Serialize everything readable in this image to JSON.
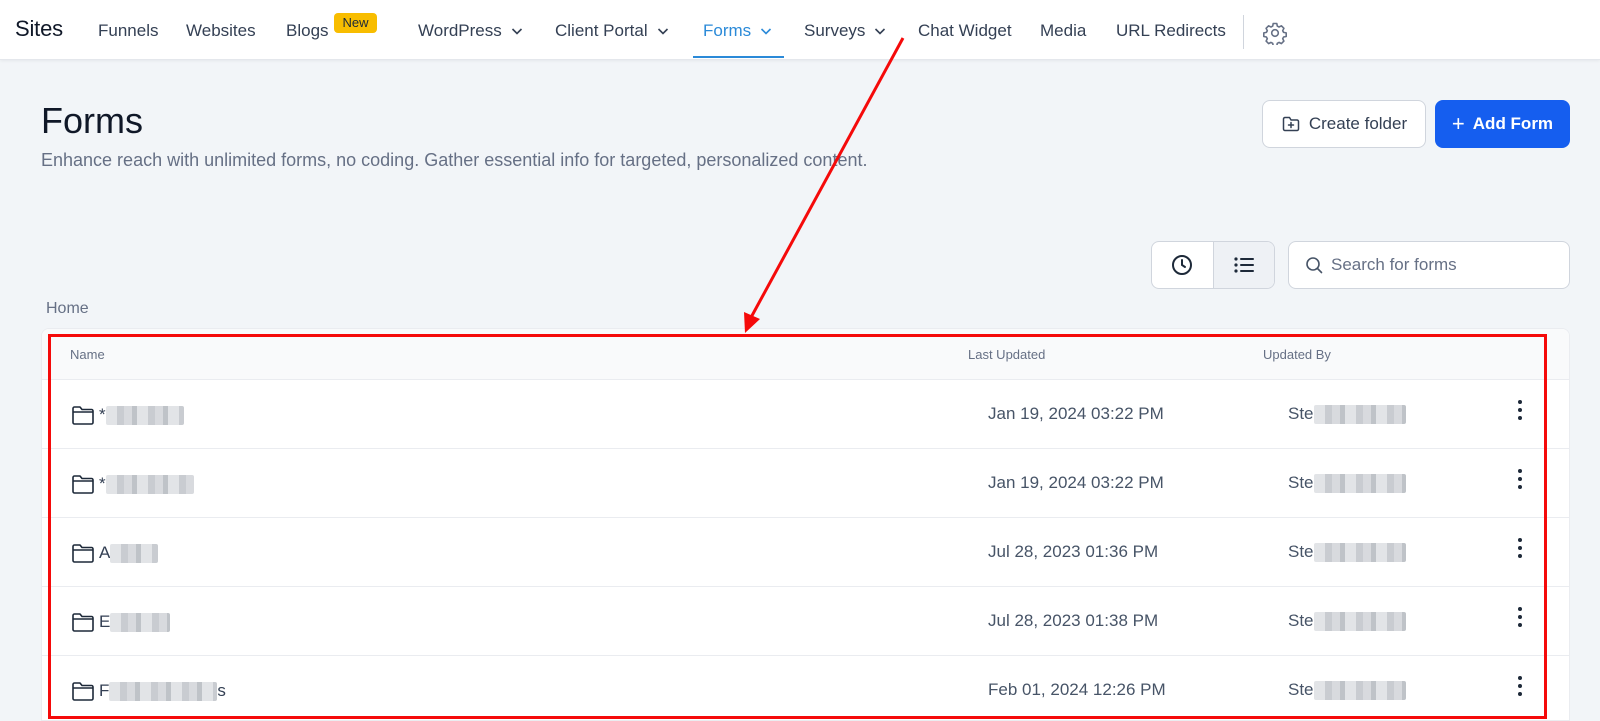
{
  "nav": {
    "brand": "Sites",
    "items": [
      {
        "label": "Funnels"
      },
      {
        "label": "Websites"
      },
      {
        "label": "Blogs",
        "badge": "New"
      },
      {
        "label": "WordPress",
        "dropdown": true
      },
      {
        "label": "Client Portal",
        "dropdown": true
      },
      {
        "label": "Forms",
        "dropdown": true,
        "active": true
      },
      {
        "label": "Surveys",
        "dropdown": true
      },
      {
        "label": "Chat Widget"
      },
      {
        "label": "Media"
      },
      {
        "label": "URL Redirects"
      }
    ],
    "settings_icon": "gear-icon"
  },
  "header": {
    "title": "Forms",
    "description": "Enhance reach with unlimited forms, no coding. Gather essential info for targeted, personalized content.",
    "create_folder_label": "Create folder",
    "add_form_label": "Add Form"
  },
  "toolbar": {
    "recent_view_icon": "clock-icon",
    "list_view_icon": "list-icon",
    "search_placeholder": "Search for forms"
  },
  "breadcrumb": "Home",
  "table": {
    "columns": [
      "Name",
      "Last Updated",
      "Updated By"
    ],
    "rows": [
      {
        "name": "*",
        "last_updated": "Jan 19, 2024 03:22 PM",
        "updated_by": "Ste"
      },
      {
        "name": "*",
        "last_updated": "Jan 19, 2024 03:22 PM",
        "updated_by": "Ste"
      },
      {
        "name": "A",
        "last_updated": "Jul 28, 2023 01:36 PM",
        "updated_by": "Ste"
      },
      {
        "name": "E",
        "last_updated": "Jul 28, 2023 01:38 PM",
        "updated_by": "Ste"
      },
      {
        "name": "F",
        "name_end": "s",
        "last_updated": "Feb 01, 2024 12:26 PM",
        "updated_by": "Ste"
      }
    ]
  },
  "colors": {
    "accent": "#2b8ad8",
    "primary_button": "#155eef",
    "badge": "#f8bd00",
    "annotation": "#f50a0a"
  }
}
